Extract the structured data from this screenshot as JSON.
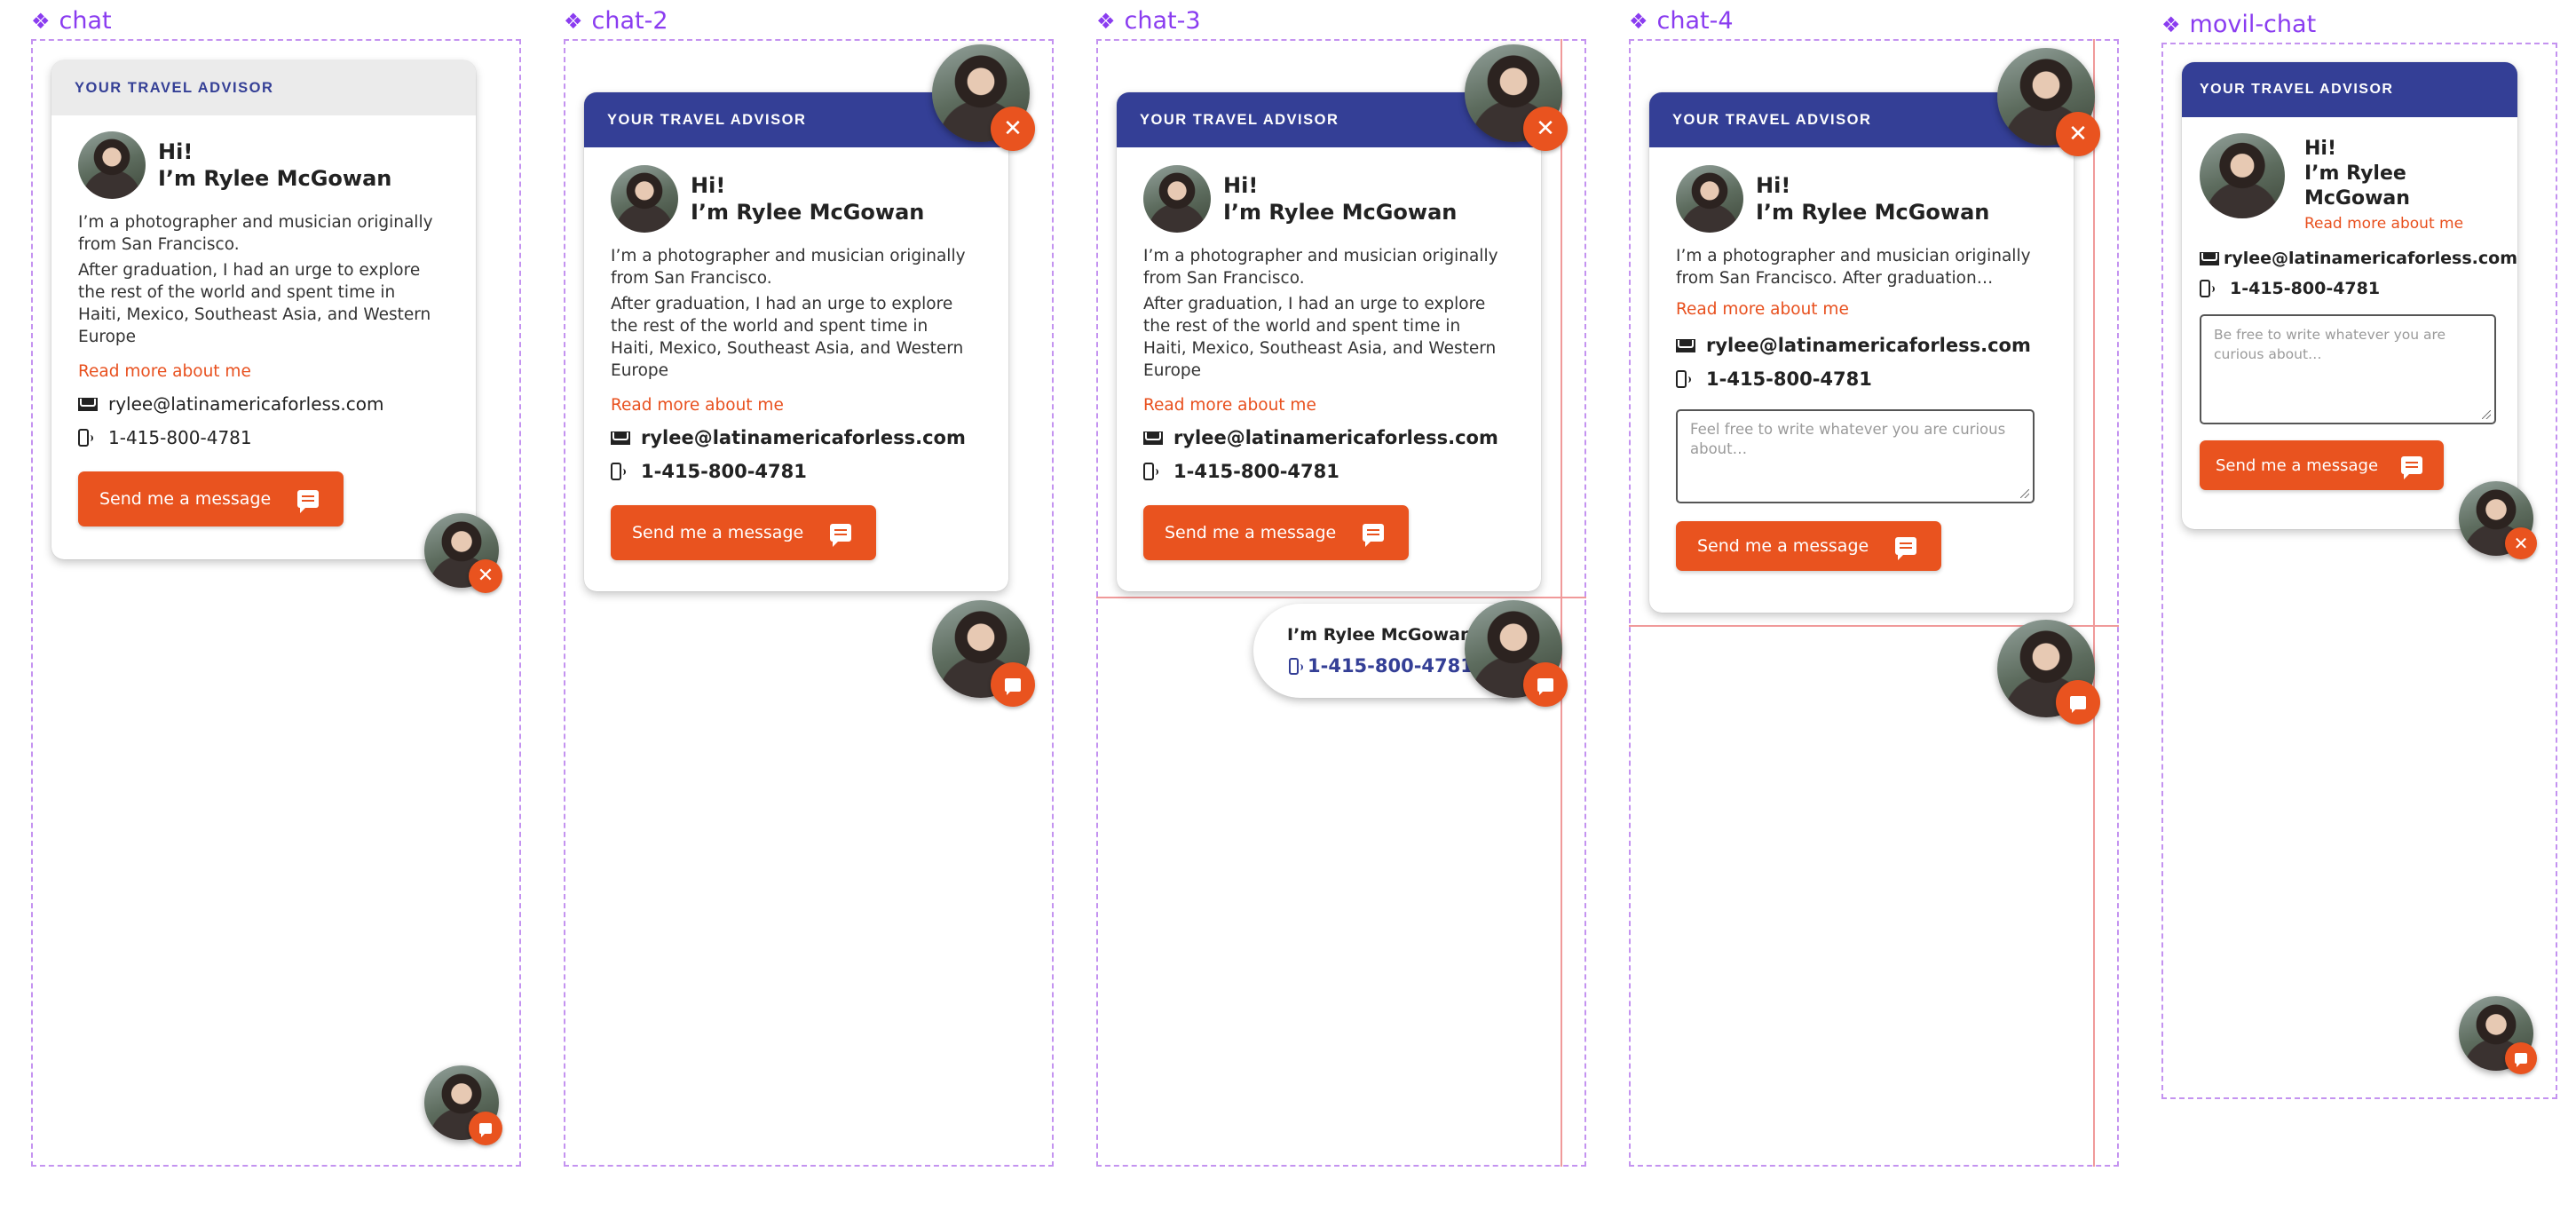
{
  "frames": [
    {
      "label": "chat",
      "header": "YOUR TRAVEL ADVISOR",
      "greeting": "Hi!",
      "name": "I’m Rylee McGowan",
      "bio1": "I’m a photographer and musician originally from San Francisco.",
      "bio2": "After graduation, I had an urge to explore the rest of the world and spent time in Haiti, Mexico, Southeast Asia, and Western Europe",
      "read_more": "Read more about me",
      "email": "rylee@latinamericaforless.com",
      "phone": "1-415-800-4781",
      "send": "Send me a message"
    },
    {
      "label": "chat-2",
      "header": "YOUR TRAVEL ADVISOR",
      "greeting": "Hi!",
      "name": "I’m Rylee McGowan",
      "bio1": "I’m a photographer and musician originally from San Francisco.",
      "bio2": "After graduation, I had an urge to explore the rest of the world and spent time in Haiti, Mexico, Southeast Asia, and Western Europe",
      "read_more": "Read more about me",
      "email": "rylee@latinamericaforless.com",
      "phone": "1-415-800-4781",
      "send": "Send me a message"
    },
    {
      "label": "chat-3",
      "header": "YOUR TRAVEL ADVISOR",
      "greeting": "Hi!",
      "name": "I’m Rylee McGowan",
      "bio1": "I’m a photographer and musician originally from San Francisco.",
      "bio2": "After graduation, I had an urge to explore the rest of the world and spent time in Haiti, Mexico, Southeast Asia, and Western Europe",
      "read_more": "Read more about me",
      "email": "rylee@latinamericaforless.com",
      "phone": "1-415-800-4781",
      "send": "Send me a message",
      "pill_name": "I’m Rylee McGowan",
      "pill_phone": "1-415-800-4781"
    },
    {
      "label": "chat-4",
      "header": "YOUR TRAVEL ADVISOR",
      "greeting": "Hi!",
      "name": "I’m Rylee McGowan",
      "bio1": "I’m a photographer and musician originally from San Francisco. After graduation…",
      "read_more": "Read more about me",
      "email": "rylee@latinamericaforless.com",
      "phone": "1-415-800-4781",
      "placeholder": "Feel free to write whatever you are curious about…",
      "send": "Send me a message"
    },
    {
      "label": "movil-chat",
      "header": "YOUR TRAVEL ADVISOR",
      "greeting": "Hi!",
      "name": "I’m Rylee McGowan",
      "read_more": "Read more about me",
      "email": "rylee@latinamericaforless.com",
      "phone": "1-415-800-4781",
      "placeholder": "Be free to write whatever you are curious about…",
      "send": "Send me a message"
    }
  ],
  "icons": {
    "frame": "component-diamond-icon",
    "close": "close-icon",
    "chat": "chat-bubble-icon",
    "email": "mail-icon",
    "phone": "mobile-phone-icon"
  },
  "colors": {
    "accent": "#e9531f",
    "brand": "#343f96",
    "frame_border": "#c493f0",
    "frame_label": "#8a3cf0",
    "guide": "#f09a9a"
  }
}
